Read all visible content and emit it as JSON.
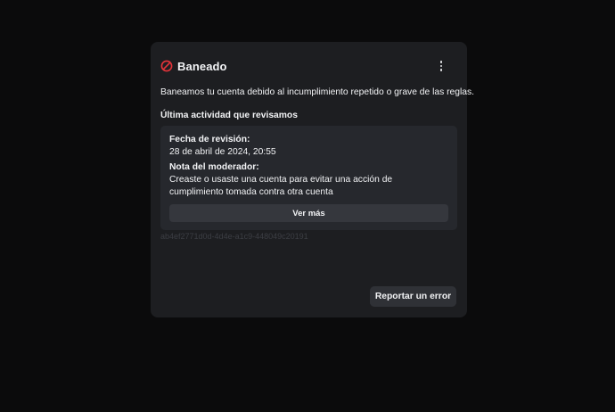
{
  "status": {
    "title": "Baneado",
    "icon": "ban-icon",
    "icon_color": "#e5343a",
    "menu_icon": "more-vertical-icon"
  },
  "description": "Baneamos tu cuenta debido al incumplimiento repetido o grave de las reglas.",
  "activity": {
    "heading": "Última actividad que revisamos",
    "review_date_label": "Fecha de revisión:",
    "review_date_value": "28 de abril de 2024, 20:55",
    "moderator_note_label": "Nota del moderador:",
    "moderator_note_value": "Creaste o usaste una cuenta para evitar una acción de cumplimiento tomada contra otra cuenta",
    "more_button_label": "Ver más"
  },
  "reference_id": "ab4ef2771d0d-4d4e-a1c9-448049c20191",
  "report_button_label": "Reportar un error"
}
